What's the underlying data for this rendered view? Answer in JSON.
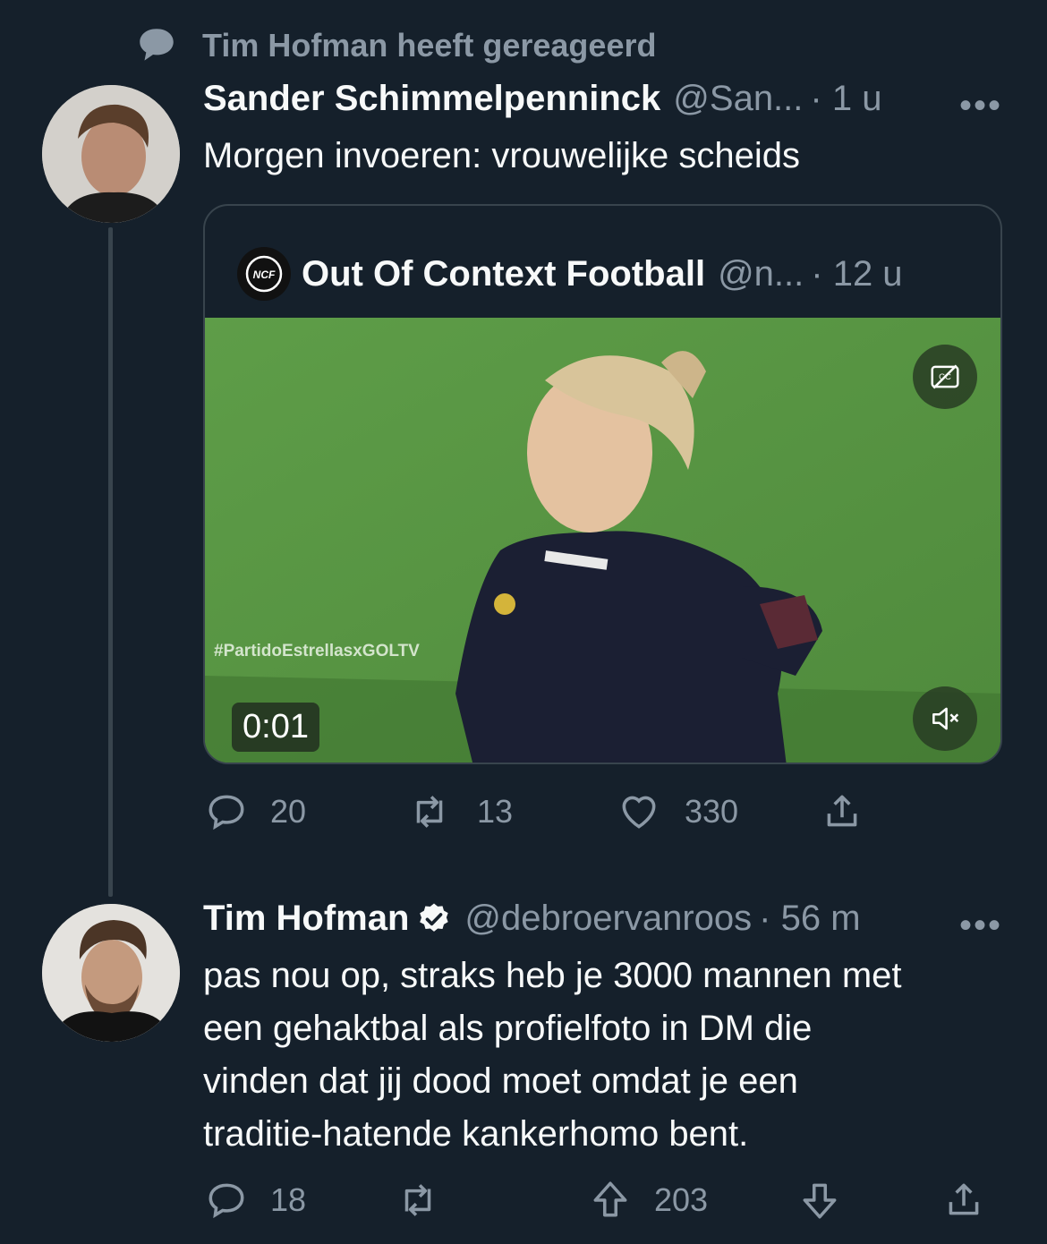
{
  "context": {
    "text": "Tim Hofman heeft gereageerd",
    "icon": "speech-bubble-icon"
  },
  "tweet1": {
    "name": "Sander Schimmelpenninck",
    "handle": "@San...",
    "time": "· 1 u",
    "more": "•••",
    "text": "Morgen invoeren: vrouwelijke scheids",
    "quote": {
      "name": "Out Of Context Football",
      "handle": "@n...",
      "time": "· 12 u",
      "logo_text": "NCF",
      "video_timer": "0:01",
      "watermark": "#PartidoEstrellasxGOLTV"
    },
    "actions": {
      "replies": "20",
      "retweets": "13",
      "likes": "330"
    }
  },
  "tweet2": {
    "name": "Tim Hofman",
    "verified": true,
    "handle": "@debroervanroos",
    "time": "· 56 m",
    "more": "•••",
    "lines": [
      "pas nou op, straks heb je 3000 mannen met",
      "een gehaktbal als profielfoto in DM die",
      "vinden dat jij dood moet omdat je een",
      "traditie-hatende kankerhomo bent."
    ],
    "actions": {
      "replies": "18",
      "upvotes": "203"
    }
  },
  "colors": {
    "background": "#15202b",
    "muted": "#8b98a5",
    "text": "#f7f9f9",
    "border": "#38444d"
  }
}
